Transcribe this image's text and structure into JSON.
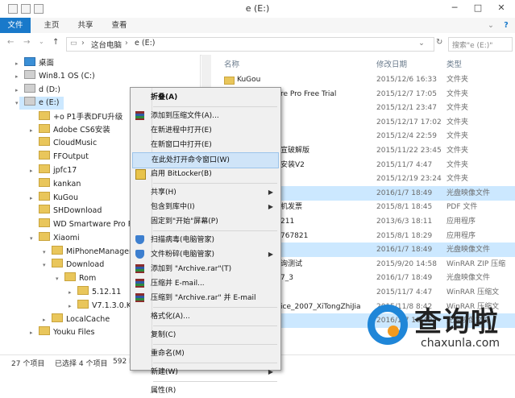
{
  "window": {
    "title": "e (E:)"
  },
  "ribbon": {
    "tabs": [
      {
        "label": "文件",
        "active": true
      },
      {
        "label": "主页"
      },
      {
        "label": "共享"
      },
      {
        "label": "查看"
      }
    ]
  },
  "address": {
    "path": [
      "这台电脑",
      "e (E:)"
    ],
    "search_placeholder": "搜索\"e (E:)\""
  },
  "nav_tree": [
    {
      "label": "桌面",
      "icon": "desktop-icon"
    },
    {
      "label": "Win8.1 OS (C:)",
      "icon": "drive-icon"
    },
    {
      "label": "d (D:)",
      "icon": "drive-icon"
    },
    {
      "label": "e (E:)",
      "icon": "drive-icon",
      "selected": true
    },
    {
      "label": "+o P1手表DFU升级",
      "icon": "folder-icon"
    },
    {
      "label": "Adobe CS6安装",
      "icon": "folder-icon"
    },
    {
      "label": "CloudMusic",
      "icon": "folder-icon"
    },
    {
      "label": "FFOutput",
      "icon": "folder-icon"
    },
    {
      "label": "jpfc17",
      "icon": "folder-icon"
    },
    {
      "label": "kankan",
      "icon": "folder-icon"
    },
    {
      "label": "KuGou",
      "icon": "folder-icon"
    },
    {
      "label": "SHDownload",
      "icon": "folder-icon"
    },
    {
      "label": "WD Smartware Pro Free Tr",
      "icon": "folder-icon"
    },
    {
      "label": "Xiaomi",
      "icon": "folder-icon"
    },
    {
      "label": "MiPhoneManager",
      "icon": "folder-icon"
    },
    {
      "label": "Download",
      "icon": "folder-icon"
    },
    {
      "label": "Rom",
      "icon": "folder-icon"
    },
    {
      "label": "5.12.11",
      "icon": "folder-icon"
    },
    {
      "label": "V7.1.3.0.KXDCNCK",
      "icon": "folder-icon"
    },
    {
      "label": "LocalCache",
      "icon": "folder-icon"
    },
    {
      "label": "Youku Files",
      "icon": "folder-icon"
    }
  ],
  "file_list": {
    "columns": [
      "名称",
      "修改日期",
      "类型"
    ],
    "rows": [
      {
        "name": "KuGou",
        "date": "2015/12/6 16:33",
        "type": "文件夹",
        "folder": true
      },
      {
        "name": "re Pro Free Trial",
        "date": "2015/12/7 17:05",
        "type": "文件夹",
        "folder": true
      },
      {
        "name": "",
        "date": "2015/12/1 23:47",
        "type": "文件夹",
        "folder": true
      },
      {
        "name": "",
        "date": "2015/12/17 17:02",
        "type": "文件夹",
        "folder": true
      },
      {
        "name": "",
        "date": "2015/12/4 22:59",
        "type": "文件夹",
        "folder": true
      },
      {
        "name": "宣破解版",
        "date": "2015/11/22 23:45",
        "type": "文件夹",
        "folder": true
      },
      {
        "name": "安装V2",
        "date": "2015/11/7 4:47",
        "type": "文件夹",
        "folder": true
      },
      {
        "name": "",
        "date": "2015/12/19 23:24",
        "type": "文件夹",
        "folder": true
      },
      {
        "name": "",
        "date": "2016/1/7 18:49",
        "type": "光盘映像文件",
        "folder": false,
        "selected": true
      },
      {
        "name": "机发票",
        "date": "2015/8/1 18:45",
        "type": "PDF 文件",
        "folder": false
      },
      {
        "name": "211",
        "date": "2013/6/3 18:11",
        "type": "应用程序",
        "folder": false
      },
      {
        "name": "767821",
        "date": "2015/8/1 18:29",
        "type": "应用程序",
        "folder": false
      },
      {
        "name": "",
        "date": "2016/1/7 18:49",
        "type": "光盘映像文件",
        "folder": false,
        "selected": true
      },
      {
        "name": "询测试",
        "date": "2015/9/20 14:58",
        "type": "WinRAR ZIP 压缩",
        "folder": false
      },
      {
        "name": "7_3",
        "date": "2016/1/7 18:49",
        "type": "光盘映像文件",
        "folder": false
      },
      {
        "name": "",
        "date": "2015/11/7 4:47",
        "type": "WinRAR 压缩文",
        "folder": false
      },
      {
        "name": "ice_2007_XiTongZhiJia",
        "date": "2015/11/8 8:42",
        "type": "WinRAR 压缩文",
        "folder": false
      },
      {
        "name": "",
        "date": "2016/1/7 18:49",
        "type": "光盘映像文件",
        "folder": false,
        "selected": true
      }
    ]
  },
  "context_menu": [
    {
      "label": "折叠(A)",
      "bold": true
    },
    {
      "sep": true
    },
    {
      "label": "添加到压缩文件(A)...",
      "icon": "winrar-icon"
    },
    {
      "label": "在新进程中打开(E)"
    },
    {
      "label": "在新窗口中打开(E)"
    },
    {
      "label": "在此处打开命令窗口(W)",
      "highlighted": true
    },
    {
      "label": "启用 BitLocker(B)",
      "icon": "bitlocker-icon"
    },
    {
      "sep": true
    },
    {
      "label": "共享(H)",
      "submenu": true
    },
    {
      "label": "包含到库中(I)",
      "submenu": true
    },
    {
      "label": "固定到\"开始\"屏幕(P)"
    },
    {
      "sep": true
    },
    {
      "label": "扫描病毒(电脑管家)",
      "icon": "shield-icon"
    },
    {
      "label": "文件粉碎(电脑管家)",
      "icon": "shield-icon",
      "submenu": true
    },
    {
      "label": "添加到 \"Archive.rar\"(T)",
      "icon": "winrar-icon"
    },
    {
      "label": "压缩并 E-mail...",
      "icon": "winrar-icon"
    },
    {
      "label": "压缩到 \"Archive.rar\" 并 E-mail",
      "icon": "winrar-icon"
    },
    {
      "sep": true
    },
    {
      "label": "格式化(A)..."
    },
    {
      "sep": true
    },
    {
      "label": "复制(C)"
    },
    {
      "sep": true
    },
    {
      "label": "重命名(M)"
    },
    {
      "sep": true
    },
    {
      "label": "新建(W)",
      "submenu": true
    },
    {
      "sep": true
    },
    {
      "label": "属性(R)"
    }
  ],
  "status": {
    "items_count": "27 个项目",
    "selected": "已选择 4 个项目",
    "size": "592 M"
  },
  "watermark": {
    "title": "查询啦",
    "url": "chaxunla.com"
  },
  "colors": {
    "accent": "#1979ca",
    "selection": "#cce8ff",
    "menu_highlight": "#cfe4f8"
  }
}
